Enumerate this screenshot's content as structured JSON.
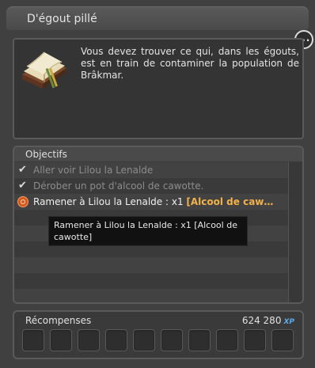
{
  "quest": {
    "title": "D'égout pillé",
    "description": "Vous devez trouver ce qui, dans les égouts, est en train de contaminer la population de Brâkmar."
  },
  "objectives": {
    "header": "Objectifs",
    "items": [
      {
        "text": "Aller voir Lilou la Lenalde",
        "status": "done",
        "icon": "check-icon"
      },
      {
        "text": "Dérober un pot d'alcool de cawotte.",
        "status": "done",
        "icon": "check-icon"
      },
      {
        "text": "Ramener à Lilou la Lenalde : x1 ",
        "highlight": "[Alcool de caw…",
        "status": "active",
        "icon": "target-icon"
      }
    ],
    "tooltip": "Ramener à Lilou la Lenalde : x1 [Alcool de cawotte]"
  },
  "rewards": {
    "header": "Récompenses",
    "xp_value": "624 280",
    "xp_unit": "XP",
    "slot_count": 10
  },
  "colors": {
    "highlight": "#f2b24a",
    "xp_blue": "#5aa9e8",
    "active_icon": "#d9561e"
  }
}
